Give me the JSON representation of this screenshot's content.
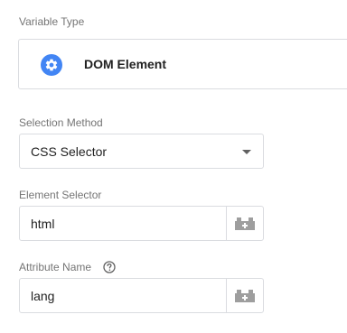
{
  "variable_type": {
    "label": "Variable Type",
    "value": "DOM Element",
    "icon": "gear-icon",
    "icon_color": "#4285f4"
  },
  "selection_method": {
    "label": "Selection Method",
    "value": "CSS Selector"
  },
  "element_selector": {
    "label": "Element Selector",
    "value": "html",
    "picker_icon": "building-block-icon"
  },
  "attribute_name": {
    "label": "Attribute Name",
    "value": "lang",
    "help_icon": "help-icon",
    "picker_icon": "building-block-icon"
  }
}
